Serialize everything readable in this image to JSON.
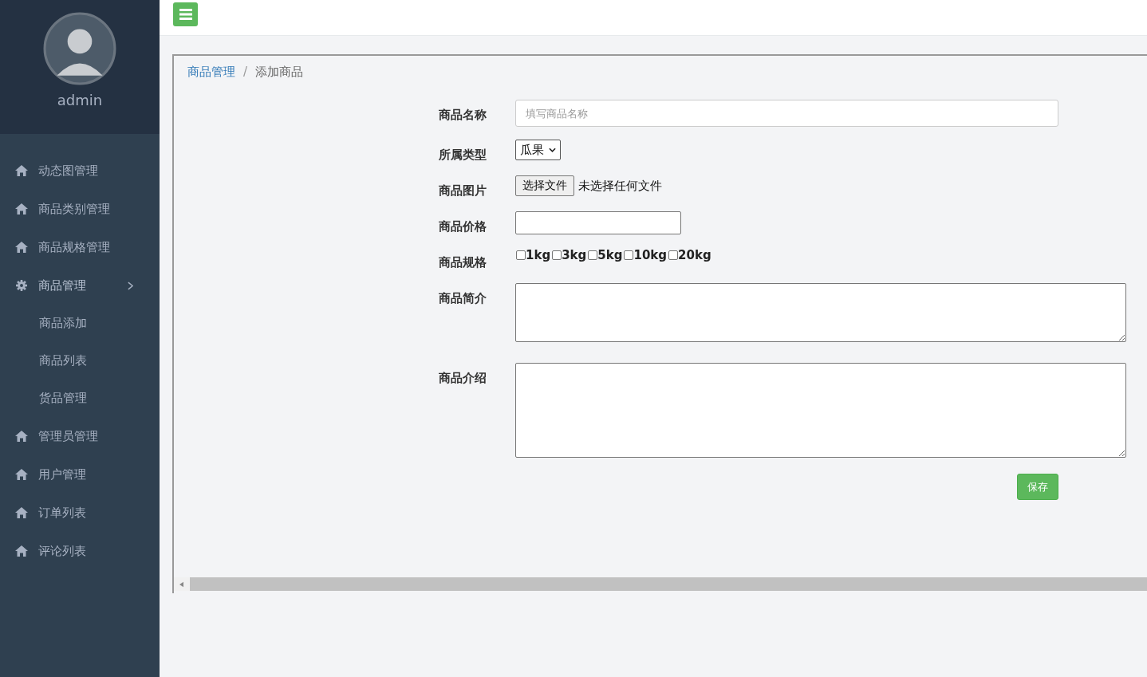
{
  "sidebar": {
    "user": "admin",
    "items": [
      {
        "kind": "link",
        "label": "动态图管理"
      },
      {
        "kind": "link",
        "label": "商品类别管理"
      },
      {
        "kind": "link",
        "label": "商品规格管理"
      },
      {
        "kind": "group",
        "label": "商品管理",
        "expanded": true,
        "children": [
          {
            "label": "商品添加"
          },
          {
            "label": "商品列表"
          },
          {
            "label": "货品管理"
          }
        ]
      },
      {
        "kind": "link",
        "label": "管理员管理"
      },
      {
        "kind": "link",
        "label": "用户管理"
      },
      {
        "kind": "link",
        "label": "订单列表"
      },
      {
        "kind": "link",
        "label": "评论列表"
      }
    ]
  },
  "breadcrumb": {
    "separator": "/",
    "items": [
      "商品管理",
      "添加商品"
    ]
  },
  "form": {
    "fields": [
      {
        "kind": "text",
        "label": "商品名称",
        "placeholder": "填写商品名称"
      },
      {
        "kind": "select",
        "label": "所属类型",
        "value": "瓜果"
      },
      {
        "kind": "file",
        "label": "商品图片",
        "button": "选择文件",
        "status": "未选择任何文件"
      },
      {
        "kind": "short",
        "label": "商品价格"
      },
      {
        "kind": "checks",
        "label": "商品规格",
        "options": [
          {
            "label": "1kg",
            "checked": false
          },
          {
            "label": "3kg",
            "checked": false
          },
          {
            "label": "5kg",
            "checked": false
          },
          {
            "label": "10kg",
            "checked": false
          },
          {
            "label": "20kg",
            "checked": false
          }
        ]
      },
      {
        "kind": "textarea",
        "label": "商品简介"
      },
      {
        "kind": "tallarea",
        "label": "商品介绍"
      }
    ],
    "save": "保存"
  }
}
